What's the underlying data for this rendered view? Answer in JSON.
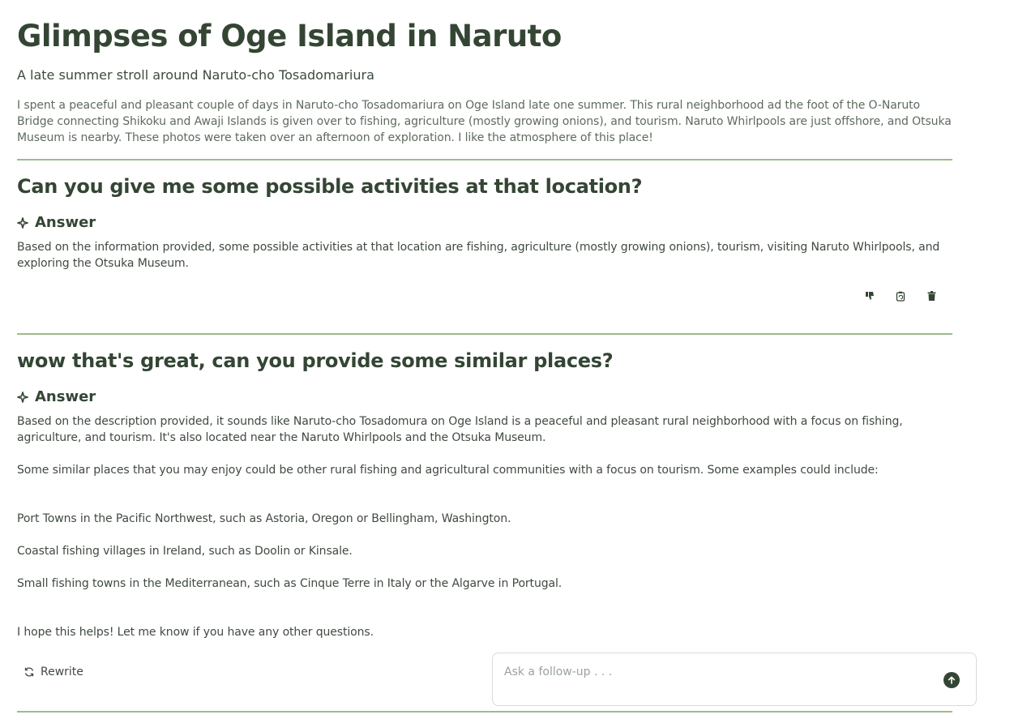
{
  "header": {
    "title": "Glimpses of Oge Island in Naruto",
    "subtitle": "A late summer stroll around Naruto-cho Tosadomariura",
    "intro": "I spent a peaceful and pleasant couple of days in Naruto-cho Tosadomariura on Oge Island late one summer. This rural neighborhood ad the foot of the O-Naruto Bridge connecting Shikoku and Awaji Islands is given over to fishing, agriculture (mostly growing onions), and tourism. Naruto Whirlpools are just offshore, and Otsuka Museum is nearby. These photos were taken over an afternoon of exploration. I like the atmosphere of this place!"
  },
  "qa": [
    {
      "question": "Can you give me some possible activities at that location?",
      "answer_label": "Answer",
      "answer": "Based on the information provided, some possible activities at that location are fishing, agriculture (mostly growing onions), tourism, visiting Naruto Whirlpools, and exploring the Otsuka Museum."
    },
    {
      "question": "wow that's great, can you provide some similar places?",
      "answer_label": "Answer",
      "answer_paragraphs": [
        "Based on the description provided, it sounds like Naruto-cho Tosadomura on Oge Island is a peaceful and pleasant rural neighborhood with a focus on fishing, agriculture, and tourism. It's also located near the Naruto Whirlpools and the Otsuka Museum.",
        "Some similar places that you may enjoy could be other rural fishing and agricultural communities with a focus on tourism. Some examples could include:",
        "Port Towns in the Pacific Northwest, such as Astoria, Oregon or Bellingham, Washington.",
        "Coastal fishing villages in Ireland, such as Doolin or Kinsale.",
        "Small fishing towns in the Mediterranean, such as Cinque Terre in Italy or the Algarve in Portugal.",
        "I hope this helps! Let me know if you have any other questions."
      ]
    }
  ],
  "actions": {
    "icons": [
      "thumbs-down-icon",
      "copy-icon",
      "trash-icon"
    ]
  },
  "rewrite_label": "Rewrite",
  "followup": {
    "placeholder": "Ask a follow-up . . ."
  },
  "colors": {
    "accent": "#344534",
    "divider": "#9dbb8c"
  }
}
